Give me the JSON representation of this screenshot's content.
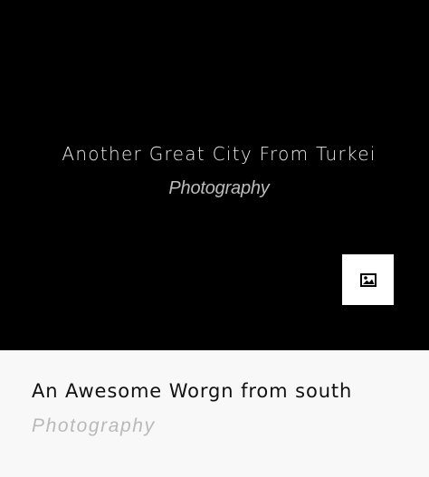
{
  "hero": {
    "title": "Another Great City From Turkei",
    "category": "Photography",
    "background_color": "#000000",
    "button_icon": "image-icon"
  },
  "caption": {
    "title": "An Awesome Worgn from south",
    "category": "Photography",
    "background_color": "#f8f8f8"
  }
}
